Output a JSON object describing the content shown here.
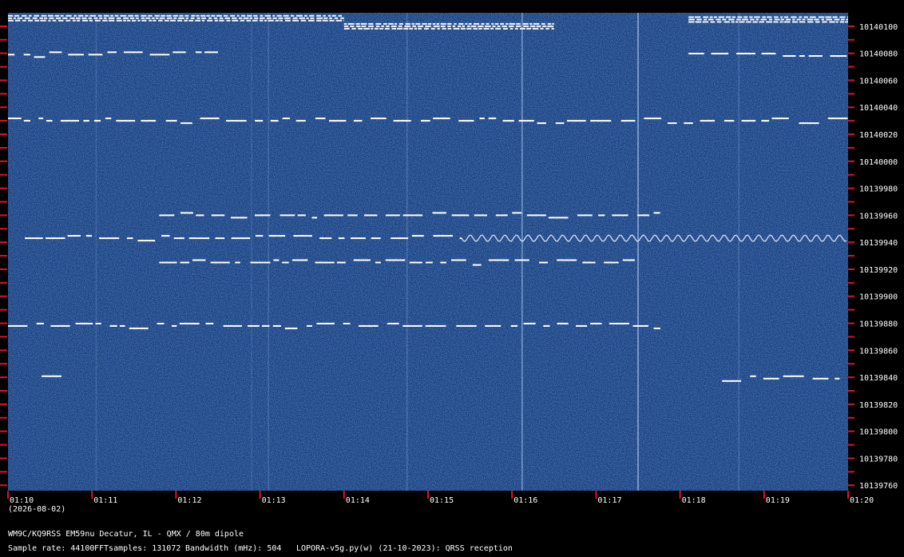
{
  "chart_data": {
    "type": "heatmap",
    "title": "",
    "xlabel": "",
    "ylabel": "",
    "date": "(2026-08-02)",
    "x_ticks": [
      "01:10",
      "01:11",
      "01:12",
      "01:13",
      "01:14",
      "01:15",
      "01:16",
      "01:17",
      "01:18",
      "01:19",
      "01:20"
    ],
    "y_ticks": [
      "10140100",
      "10140080",
      "10140060",
      "10140040",
      "10140020",
      "10140000",
      "10139980",
      "10139960",
      "10139940",
      "10139920",
      "10139900",
      "10139880",
      "10139860",
      "10139840",
      "10139820",
      "10139800",
      "10139780",
      "10139760"
    ],
    "x_range_minutes": [
      0,
      10
    ],
    "y_range_hz": [
      10139756,
      10140110
    ],
    "background_color": "#123a78",
    "signal_color": "#ffffff",
    "tick_color": "#e0102a",
    "signal_traces": [
      {
        "freq_hz": 10140106,
        "t_start": 0.0,
        "t_end": 4.0,
        "pattern": "dense"
      },
      {
        "freq_hz": 10140100,
        "t_start": 4.0,
        "t_end": 6.5,
        "pattern": "dense"
      },
      {
        "freq_hz": 10140105,
        "t_start": 8.1,
        "t_end": 10.0,
        "pattern": "dense"
      },
      {
        "freq_hz": 10140079,
        "t_start": 0.0,
        "t_end": 2.5,
        "pattern": "dash"
      },
      {
        "freq_hz": 10140078,
        "t_start": 8.1,
        "t_end": 10.0,
        "pattern": "dash"
      },
      {
        "freq_hz": 10140030,
        "t_start": 0.0,
        "t_end": 10.0,
        "pattern": "dash"
      },
      {
        "freq_hz": 10139960,
        "t_start": 1.8,
        "t_end": 7.8,
        "pattern": "dash"
      },
      {
        "freq_hz": 10139943,
        "t_start": 0.2,
        "t_end": 5.4,
        "pattern": "dash"
      },
      {
        "freq_hz": 10139943,
        "t_start": 5.4,
        "t_end": 10.0,
        "pattern": "wave"
      },
      {
        "freq_hz": 10139925,
        "t_start": 1.8,
        "t_end": 7.5,
        "pattern": "dash"
      },
      {
        "freq_hz": 10139878,
        "t_start": 0.0,
        "t_end": 7.8,
        "pattern": "dash"
      },
      {
        "freq_hz": 10139839,
        "t_start": 0.4,
        "t_end": 0.7,
        "pattern": "dash"
      },
      {
        "freq_hz": 10139839,
        "t_start": 8.5,
        "t_end": 10.0,
        "pattern": "dash"
      }
    ]
  },
  "footer": {
    "station": "WM9C/KQ9RSS EM59nu Decatur, IL - QMX / 80m dipole",
    "sample_rate": "Sample rate: 44100",
    "fft_samples": "FFTsamples: 131072",
    "bandwidth": "Bandwidth (mHz): 504",
    "software": "LOPORA-v5g.py(w) (21-10-2023): QRSS reception"
  }
}
